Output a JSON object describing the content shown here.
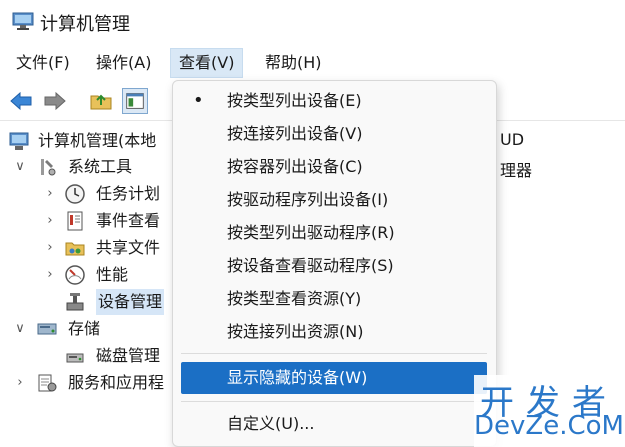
{
  "window": {
    "title": "计算机管理"
  },
  "menubar": {
    "items": [
      {
        "label": "文件(F)"
      },
      {
        "label": "操作(A)"
      },
      {
        "label": "查看(V)"
      },
      {
        "label": "帮助(H)"
      }
    ]
  },
  "tree": {
    "root": "计算机管理(本地",
    "system_tools": "系统工具",
    "task_scheduler": "任务计划",
    "event_viewer": "事件查看",
    "shared_folders": "共享文件",
    "performance": "性能",
    "device_manager": "设备管理",
    "storage": "存储",
    "disk_management": "磁盘管理",
    "services": "服务和应用程"
  },
  "right_pane": {
    "line1": "UD",
    "line2": "理器"
  },
  "view_menu": {
    "items": [
      {
        "label": "按类型列出设备(E)",
        "checked": true
      },
      {
        "label": "按连接列出设备(V)"
      },
      {
        "label": "按容器列出设备(C)"
      },
      {
        "label": "按驱动程序列出设备(I)"
      },
      {
        "label": "按类型列出驱动程序(R)"
      },
      {
        "label": "按设备查看驱动程序(S)"
      },
      {
        "label": "按类型查看资源(Y)"
      },
      {
        "label": "按连接列出资源(N)"
      },
      {
        "label": "显示隐藏的设备(W)",
        "highlighted": true
      },
      {
        "label": "自定义(U)..."
      }
    ],
    "check_glyph": "•"
  },
  "watermark": {
    "top": "开发者",
    "bottom": "DevZe.CoM"
  },
  "colors": {
    "highlight": "#1b6fc5",
    "menu_active": "#d9e8f6",
    "watermark": "#2b78c9"
  }
}
